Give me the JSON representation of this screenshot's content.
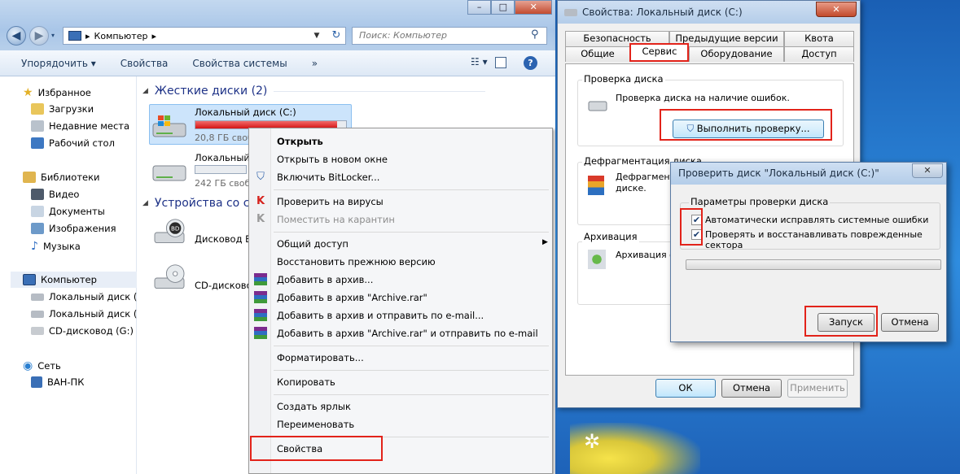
{
  "explorer": {
    "breadcrumb": "Компьютер",
    "search_placeholder": "Поиск: Компьютер",
    "win_controls": {
      "minimize": "–",
      "maximize": "□",
      "close": "✕"
    },
    "toolbar": {
      "organize": "Упорядочить ▾",
      "properties": "Свойства",
      "system_properties": "Свойства системы",
      "more": "»"
    },
    "nav": {
      "favorites": "Избранное",
      "downloads": "Загрузки",
      "recent": "Недавние места",
      "desktop": "Рабочий стол",
      "libraries": "Библиотеки",
      "video": "Видео",
      "documents": "Документы",
      "images": "Изображения",
      "music": "Музыка",
      "computer": "Компьютер",
      "drive_c": "Локальный диск (C",
      "drive_e": "Локальный диск (E",
      "drive_g": "CD-дисковод (G:)",
      "network": "Сеть",
      "pc": "ВАН-ПК"
    },
    "groups": {
      "hard_drives": "Жесткие диски (2)",
      "removable": "Устройства со съ"
    },
    "drives": [
      {
        "name": "Локальный диск (C:)",
        "free": "20,8 ГБ свобо",
        "used_fraction": 0.94
      },
      {
        "name": "Локальный",
        "free": "242 ГБ свобо",
        "used_fraction": 0.0
      },
      {
        "name": "Дисковод BI"
      },
      {
        "name": "CD-дисково"
      }
    ]
  },
  "context_menu": {
    "open": "Открыть",
    "open_new_window": "Открыть в новом окне",
    "bitlocker": "Включить BitLocker...",
    "scan_virus": "Проверить на вирусы",
    "quarantine": "Поместить на карантин",
    "sharing": "Общий доступ",
    "restore_prev": "Восстановить прежнюю версию",
    "add_archive": "Добавить в архив...",
    "add_archive_rar": "Добавить в архив \"Archive.rar\"",
    "add_archive_email": "Добавить в архив и отправить по e-mail...",
    "add_archive_rar_email": "Добавить в архив \"Archive.rar\" и отправить по e-mail",
    "format": "Форматировать...",
    "copy": "Копировать",
    "create_shortcut": "Создать ярлык",
    "rename": "Переименовать",
    "properties": "Свойства"
  },
  "props": {
    "title": "Свойства: Локальный диск (C:)",
    "close": "✕",
    "tabs_top": [
      "Безопасность",
      "Предыдущие версии",
      "Квота"
    ],
    "tabs_bottom": [
      "Общие",
      "Сервис",
      "Оборудование",
      "Доступ"
    ],
    "check": {
      "title": "Проверка диска",
      "text": "Проверка диска на наличие ошибок.",
      "button": "Выполнить проверку..."
    },
    "defrag": {
      "title": "Дефрагментация диска",
      "text_1": "Дефрагмента",
      "text_2": "диске."
    },
    "backup": {
      "title": "Архивация",
      "text": "Архивация ф"
    },
    "ok": "ОК",
    "cancel": "Отмена",
    "apply": "Применить"
  },
  "chk": {
    "title": "Проверить диск \"Локальный диск (C:)\"",
    "close": "✕",
    "group_title": "Параметры проверки диска",
    "opt_auto_fix": "Автоматически исправлять системные ошибки",
    "opt_recover": "Проверять и восстанавливать поврежденные сектора",
    "opt_auto_fix_checked": true,
    "opt_recover_checked": true,
    "progress": 0,
    "start": "Запуск",
    "cancel": "Отмена"
  }
}
